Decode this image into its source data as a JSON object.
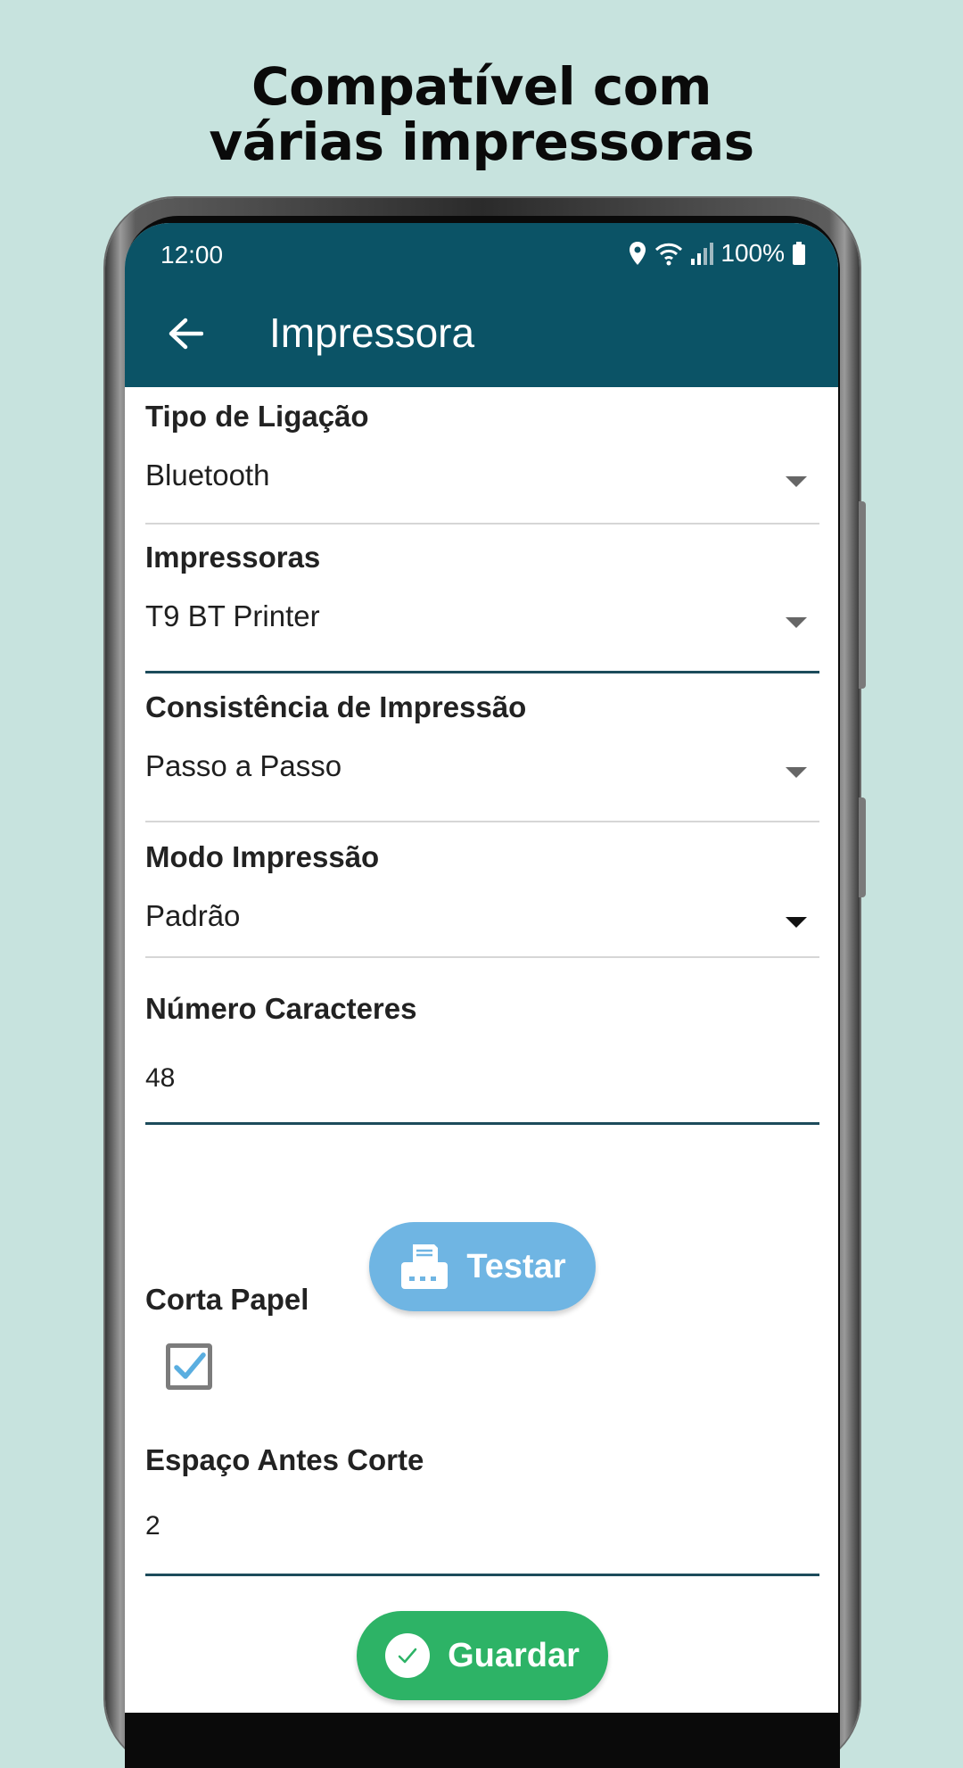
{
  "promo": {
    "title_line1": "Compatível com",
    "title_line2": "várias impressoras"
  },
  "status_bar": {
    "time": "12:00",
    "battery": "100%",
    "icons": [
      "location-icon",
      "wifi-icon",
      "signal-icon",
      "battery-icon"
    ]
  },
  "app_bar": {
    "title": "Impressora",
    "back_icon": "arrow-left-icon",
    "color": "#0b5366"
  },
  "form": {
    "connection_type": {
      "label": "Tipo de Ligação",
      "value": "Bluetooth"
    },
    "printers": {
      "label": "Impressoras",
      "value": "T9 BT Printer"
    },
    "print_consistency": {
      "label": "Consistência de Impressão",
      "value": "Passo a Passo"
    },
    "print_mode": {
      "label": "Modo Impressão",
      "value": "Padrão"
    },
    "char_count": {
      "label": "Número Caracteres",
      "value": "48"
    },
    "test_button": {
      "label": "Testar",
      "icon": "printer-icon",
      "color": "#6fb5e3"
    },
    "cut_paper": {
      "label": "Corta Papel",
      "checked": true
    },
    "space_before_cut": {
      "label": "Espaço Antes Corte",
      "value": "2"
    },
    "save_button": {
      "label": "Guardar",
      "icon": "check-circle-icon",
      "color": "#2db366"
    }
  }
}
